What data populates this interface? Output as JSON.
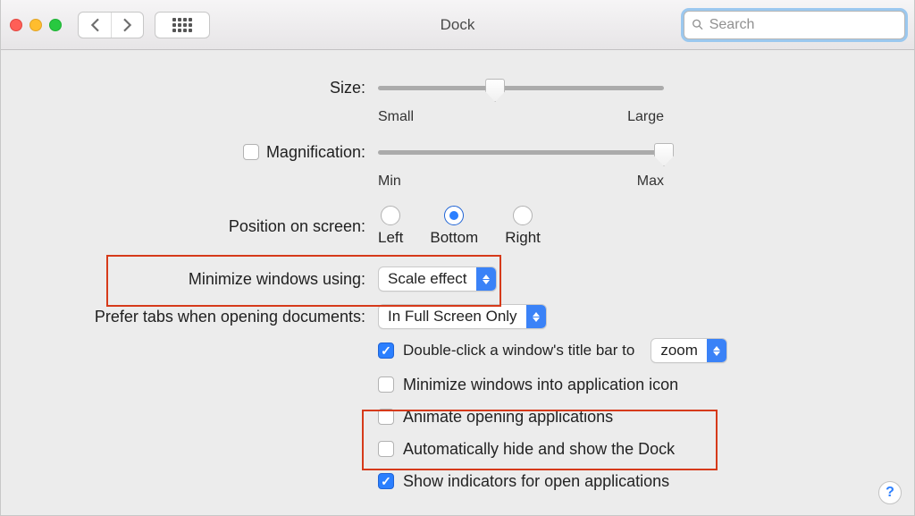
{
  "window": {
    "title": "Dock",
    "search_placeholder": "Search"
  },
  "size": {
    "label": "Size:",
    "min_tick": "Small",
    "max_tick": "Large",
    "value_pct": 41
  },
  "magnification": {
    "checkbox_checked": false,
    "label": "Magnification:",
    "min_tick": "Min",
    "max_tick": "Max",
    "value_pct": 100
  },
  "position": {
    "label": "Position on screen:",
    "options": [
      "Left",
      "Bottom",
      "Right"
    ],
    "selected_index": 1
  },
  "minimize": {
    "label": "Minimize windows using:",
    "selected": "Scale effect"
  },
  "tabs_pref": {
    "label": "Prefer tabs when opening documents:",
    "selected": "In Full Screen Only"
  },
  "double_click": {
    "checked": true,
    "label": "Double-click a window's title bar to",
    "action": "zoom"
  },
  "options": [
    {
      "checked": false,
      "label": "Minimize windows into application icon"
    },
    {
      "checked": false,
      "label": "Animate opening applications"
    },
    {
      "checked": false,
      "label": "Automatically hide and show the Dock"
    },
    {
      "checked": true,
      "label": "Show indicators for open applications"
    }
  ],
  "help_label": "?"
}
